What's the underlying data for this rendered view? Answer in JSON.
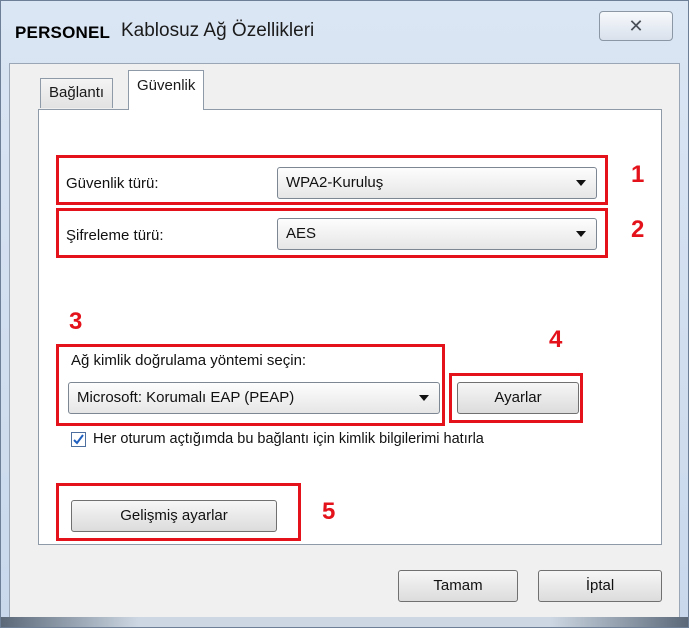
{
  "window": {
    "brand": "PERSONEL",
    "title": "Kablosuz Ağ Özellikleri",
    "close_glyph": "✕"
  },
  "tabs": [
    {
      "label": "Bağlantı",
      "selected": false
    },
    {
      "label": "Güvenlik",
      "selected": true
    }
  ],
  "security": {
    "type_label": "Güvenlik türü:",
    "type_value": "WPA2-Kuruluş",
    "encryption_label": "Şifreleme türü:",
    "encryption_value": "AES",
    "auth_label": "Ağ kimlik doğrulama yöntemi seçin:",
    "auth_value": "Microsoft: Korumalı EAP (PEAP)",
    "settings_button": "Ayarlar",
    "remember_checked": true,
    "remember_label": "Her oturum açtığımda bu bağlantı için kimlik bilgilerimi hatırla",
    "advanced_button": "Gelişmiş ayarlar"
  },
  "annotations": [
    "1",
    "2",
    "3",
    "4",
    "5"
  ],
  "footer": {
    "ok_button": "Tamam",
    "cancel_button": "İptal"
  },
  "colors": {
    "annotation_red": "#e3121b",
    "checkbox_tick": "#1f5fbf"
  }
}
